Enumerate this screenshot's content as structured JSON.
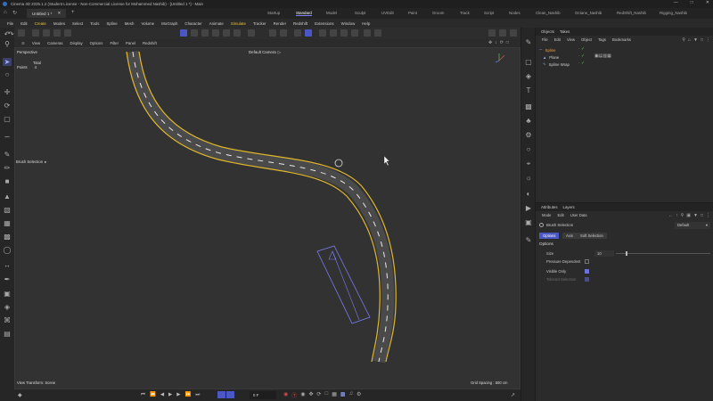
{
  "window": {
    "title": "Cinema 4D 2025.1.2 (Student License - Non-Commercial License for Mohammed Nashib) - [Untitled 1 *] - Main"
  },
  "doc_tab": {
    "label": "Untitled 1 *"
  },
  "layout_tabs": [
    "Startup",
    "Standard",
    "Model",
    "Sculpt",
    "UVEdit",
    "Paint",
    "Groom",
    "Track",
    "Script",
    "Nodes",
    "Clean_Nashib",
    "Octane_Nashib",
    "RedShift_Nashib",
    "Rigging_Nashib"
  ],
  "active_layout": "Standard",
  "menu": [
    "File",
    "Edit",
    "Create",
    "Modes",
    "Select",
    "Tools",
    "Spline",
    "Mesh",
    "Volume",
    "MoGraph",
    "Character",
    "Animate",
    "Simulate",
    "Tracker",
    "Render",
    "Redshift",
    "Extensions",
    "Window",
    "Help"
  ],
  "viewport_menu": [
    "View",
    "Cameras",
    "Display",
    "Options",
    "Filter",
    "Panel",
    "Redshift"
  ],
  "viewport": {
    "projection": "Perspective",
    "camera": "Default Camera",
    "stats_total": "Total",
    "stats_points_label": "Points",
    "stats_points_value": "4",
    "tool_label": "Brush Selection",
    "status_left": "View Transform: Scene",
    "grid_spacing": "Grid Spacing : 500 cm"
  },
  "timeline": {
    "frame": "0 F"
  },
  "objects_panel": {
    "tabs": [
      "Objects",
      "Takes"
    ],
    "menu": [
      "File",
      "Edit",
      "View",
      "Object",
      "Tags",
      "Bookmarks"
    ],
    "items": [
      {
        "name": "Spline",
        "selected": true
      },
      {
        "name": "Plane",
        "selected": false
      },
      {
        "name": "Spline Wrap",
        "selected": false
      }
    ]
  },
  "attributes_panel": {
    "tabs": [
      "Attributes",
      "Layers"
    ],
    "menu": [
      "Mode",
      "Edit",
      "User Data"
    ],
    "tool_name": "Brush Selection",
    "preset": "Default",
    "sub_tabs": [
      "Options",
      "Axis",
      "Soft Selection"
    ],
    "section": "Options",
    "size_label": "Size",
    "size_value": "10",
    "size_fraction": 0.1,
    "pressure_label": "Pressure Dependent",
    "visible_only_label": "Visible Only",
    "tolerant_label": "Tolerant Selection"
  },
  "colors": {
    "accent": "#4a57c4",
    "road_edge": "#e0b72c",
    "highlight_menu": "#e8c33b"
  }
}
